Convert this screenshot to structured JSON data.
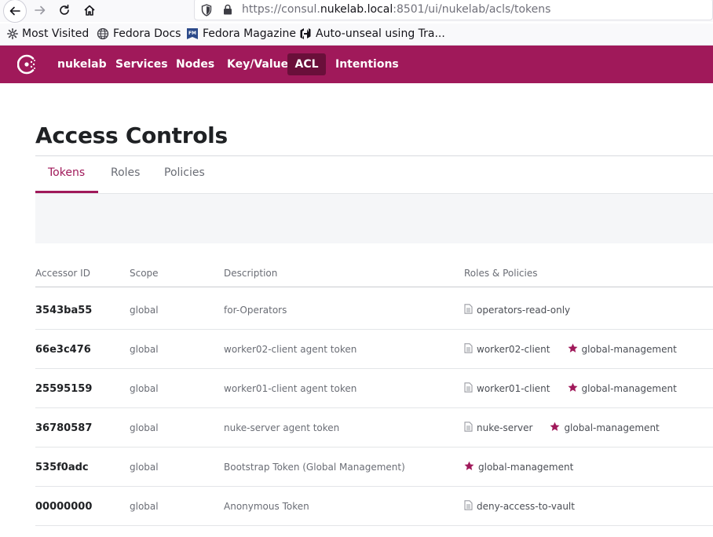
{
  "browser": {
    "url_prefix": "https://consul.",
    "url_domain": "nukelab.local",
    "url_suffix": ":8501/ui/nukelab/acls/tokens",
    "bookmarks": [
      {
        "label": "Most Visited",
        "icon": "gear-icon"
      },
      {
        "label": "Fedora Docs",
        "icon": "globe-icon"
      },
      {
        "label": "Fedora Magazine",
        "icon": "fedora-magazine-icon"
      },
      {
        "label": "Auto-unseal using Tra...",
        "icon": "hashicorp-icon"
      }
    ]
  },
  "nav": {
    "datacenter": "nukelab",
    "items": [
      "Services",
      "Nodes",
      "Key/Value",
      "ACL",
      "Intentions"
    ],
    "active": "ACL",
    "brand_color": "#a0195a"
  },
  "page": {
    "title": "Access Controls",
    "tabs": [
      "Tokens",
      "Roles",
      "Policies"
    ],
    "active_tab": "Tokens"
  },
  "table": {
    "headers": [
      "Accessor ID",
      "Scope",
      "Description",
      "Roles & Policies"
    ],
    "rows": [
      {
        "id": "3543ba55",
        "scope": "global",
        "description": "for-Operators",
        "policies": [
          {
            "name": "operators-read-only",
            "type": "policy"
          }
        ]
      },
      {
        "id": "66e3c476",
        "scope": "global",
        "description": "worker02-client agent token",
        "policies": [
          {
            "name": "worker02-client",
            "type": "policy"
          },
          {
            "name": "global-management",
            "type": "management"
          }
        ]
      },
      {
        "id": "25595159",
        "scope": "global",
        "description": "worker01-client agent token",
        "policies": [
          {
            "name": "worker01-client",
            "type": "policy"
          },
          {
            "name": "global-management",
            "type": "management"
          }
        ]
      },
      {
        "id": "36780587",
        "scope": "global",
        "description": "nuke-server agent token",
        "policies": [
          {
            "name": "nuke-server",
            "type": "policy"
          },
          {
            "name": "global-management",
            "type": "management"
          }
        ]
      },
      {
        "id": "535f0adc",
        "scope": "global",
        "description": "Bootstrap Token (Global Management)",
        "policies": [
          {
            "name": "global-management",
            "type": "management"
          }
        ]
      },
      {
        "id": "00000000",
        "scope": "global",
        "description": "Anonymous Token",
        "policies": [
          {
            "name": "deny-access-to-vault",
            "type": "policy"
          }
        ]
      }
    ]
  }
}
